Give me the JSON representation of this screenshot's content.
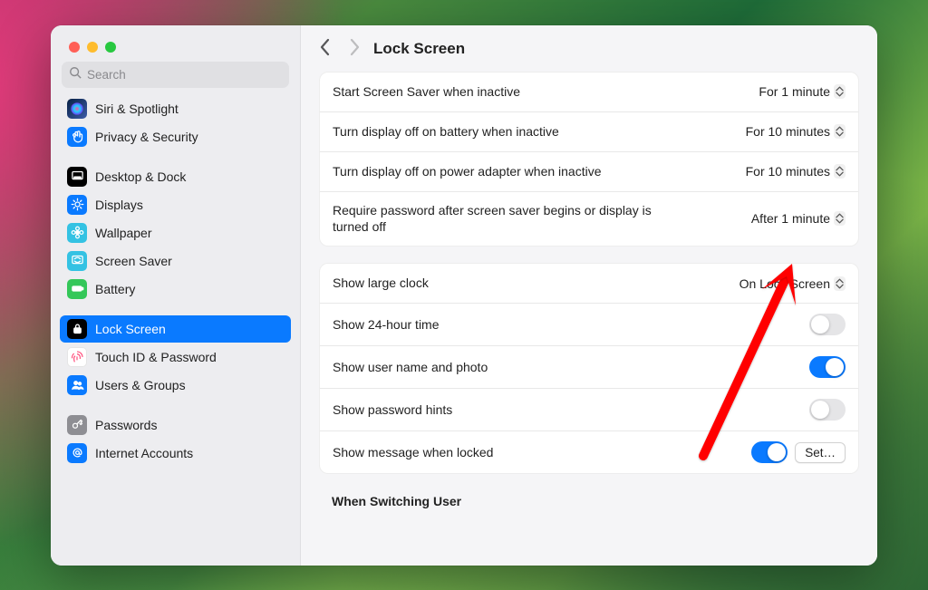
{
  "search": {
    "placeholder": "Search"
  },
  "header": {
    "title": "Lock Screen"
  },
  "sidebar": {
    "groups": [
      {
        "items": [
          {
            "id": "siri",
            "label": "Siri & Spotlight",
            "iconBg": "linear-gradient(135deg,#072043,#3d5da9)",
            "iconGlyph": "siri"
          },
          {
            "id": "privacy",
            "label": "Privacy & Security",
            "iconBg": "#0a7aff",
            "iconGlyph": "hand"
          }
        ]
      },
      {
        "items": [
          {
            "id": "desktop-dock",
            "label": "Desktop & Dock",
            "iconBg": "#000000",
            "iconGlyph": "dock"
          },
          {
            "id": "displays",
            "label": "Displays",
            "iconBg": "#0a7aff",
            "iconGlyph": "sun"
          },
          {
            "id": "wallpaper",
            "label": "Wallpaper",
            "iconBg": "#34c2e3",
            "iconGlyph": "flower"
          },
          {
            "id": "screen-saver",
            "label": "Screen Saver",
            "iconBg": "#34c2e3",
            "iconGlyph": "screen"
          },
          {
            "id": "battery",
            "label": "Battery",
            "iconBg": "#34c759",
            "iconGlyph": "battery"
          }
        ]
      },
      {
        "items": [
          {
            "id": "lock-screen",
            "label": "Lock Screen",
            "iconBg": "#000000",
            "iconGlyph": "lock",
            "selected": true
          },
          {
            "id": "touch-id",
            "label": "Touch ID & Password",
            "iconBg": "#ffffff",
            "iconGlyph": "fingerprint"
          },
          {
            "id": "users-groups",
            "label": "Users & Groups",
            "iconBg": "#0a7aff",
            "iconGlyph": "users"
          }
        ]
      },
      {
        "items": [
          {
            "id": "passwords",
            "label": "Passwords",
            "iconBg": "#8e8e93",
            "iconGlyph": "key"
          },
          {
            "id": "internet-accounts",
            "label": "Internet Accounts",
            "iconBg": "#0a7aff",
            "iconGlyph": "at"
          }
        ]
      }
    ]
  },
  "settings": {
    "card1": {
      "rows": [
        {
          "label": "Start Screen Saver when inactive",
          "control": "popup",
          "value": "For 1 minute"
        },
        {
          "label": "Turn display off on battery when inactive",
          "control": "popup",
          "value": "For 10 minutes"
        },
        {
          "label": "Turn display off on power adapter when inactive",
          "control": "popup",
          "value": "For 10 minutes"
        },
        {
          "label": "Require password after screen saver begins or display is turned off",
          "control": "popup",
          "value": "After 1 minute"
        }
      ]
    },
    "card2": {
      "rows": [
        {
          "label": "Show large clock",
          "control": "popup",
          "value": "On Lock Screen"
        },
        {
          "label": "Show 24-hour time",
          "control": "toggle",
          "on": false
        },
        {
          "label": "Show user name and photo",
          "control": "toggle",
          "on": true
        },
        {
          "label": "Show password hints",
          "control": "toggle",
          "on": false
        },
        {
          "label": "Show message when locked",
          "control": "toggle+button",
          "on": true,
          "button": "Set…"
        }
      ]
    },
    "section_heading": "When Switching User"
  }
}
